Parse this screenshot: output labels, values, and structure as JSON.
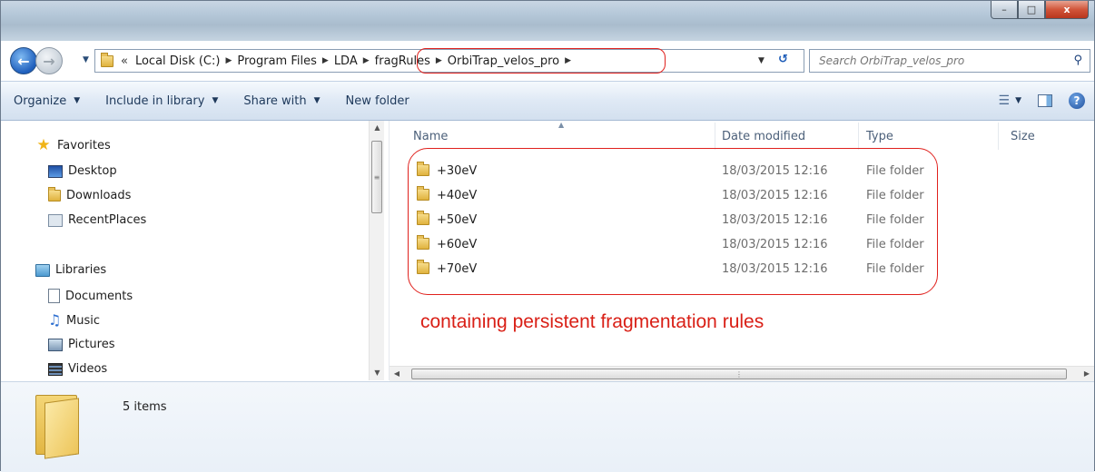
{
  "window": {
    "caption_min": "–",
    "caption_max": "□",
    "caption_close": "x"
  },
  "navigation": {
    "back_glyph": "←",
    "forward_glyph": "→"
  },
  "address": {
    "chevron": "«",
    "crumbs": [
      "Local Disk (C:)",
      "Program Files",
      "LDA",
      "fragRules",
      "OrbiTrap_velos_pro"
    ],
    "separator": "▶"
  },
  "search": {
    "placeholder": "Search OrbiTrap_velos_pro"
  },
  "toolbar": {
    "organize": "Organize",
    "include_in_library": "Include in library",
    "share_with": "Share with",
    "new_folder": "New folder",
    "caret": "▼"
  },
  "nav_pane": {
    "favorites_label": "Favorites",
    "favorites": [
      "Desktop",
      "Downloads",
      "RecentPlaces"
    ],
    "libraries_label": "Libraries",
    "libraries": [
      "Documents",
      "Music",
      "Pictures",
      "Videos"
    ]
  },
  "columns": {
    "name": "Name",
    "date_modified": "Date modified",
    "type": "Type",
    "size": "Size"
  },
  "files": [
    {
      "name": "+30eV",
      "date": "18/03/2015 12:16",
      "type": "File folder"
    },
    {
      "name": "+40eV",
      "date": "18/03/2015 12:16",
      "type": "File folder"
    },
    {
      "name": "+50eV",
      "date": "18/03/2015 12:16",
      "type": "File folder"
    },
    {
      "name": "+60eV",
      "date": "18/03/2015 12:16",
      "type": "File folder"
    },
    {
      "name": "+70eV",
      "date": "18/03/2015 12:16",
      "type": "File folder"
    }
  ],
  "annotation": "containing persistent fragmentation rules",
  "details": {
    "item_count": "5 items"
  },
  "icons": {
    "back": "back-arrow-icon",
    "forward": "forward-arrow-icon",
    "search": "search-icon",
    "help": "help-icon",
    "folder": "folder-icon"
  },
  "colors": {
    "annotation_red": "#d91f16",
    "toolbar_text": "#1e395b"
  }
}
